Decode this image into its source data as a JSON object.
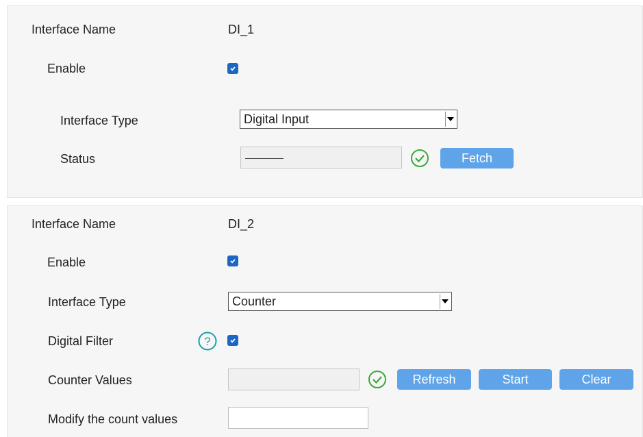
{
  "interfaces": [
    {
      "name_label": "Interface Name",
      "name_value": "DI_1",
      "enable_label": "Enable",
      "enabled": true,
      "type_label": "Interface Type",
      "type_value": "Digital Input",
      "status_label": "Status",
      "status_value": "————",
      "fetch_label": "Fetch"
    },
    {
      "name_label": "Interface Name",
      "name_value": "DI_2",
      "enable_label": "Enable",
      "enabled": true,
      "type_label": "Interface Type",
      "type_value": "Counter",
      "filter_label": "Digital Filter",
      "filter_enabled": true,
      "counter_label": "Counter Values",
      "counter_value": "",
      "refresh_label": "Refresh",
      "start_label": "Start",
      "clear_label": "Clear",
      "modify_label": "Modify the count values",
      "modify_value": ""
    }
  ],
  "colors": {
    "accent": "#1d66c2",
    "button": "#5fa3e8",
    "ok": "#3aa83a",
    "help": "#1aa0b0"
  },
  "icons": {
    "check": "checkmark",
    "ok": "check-circle-icon",
    "help": "question-circle-icon"
  }
}
